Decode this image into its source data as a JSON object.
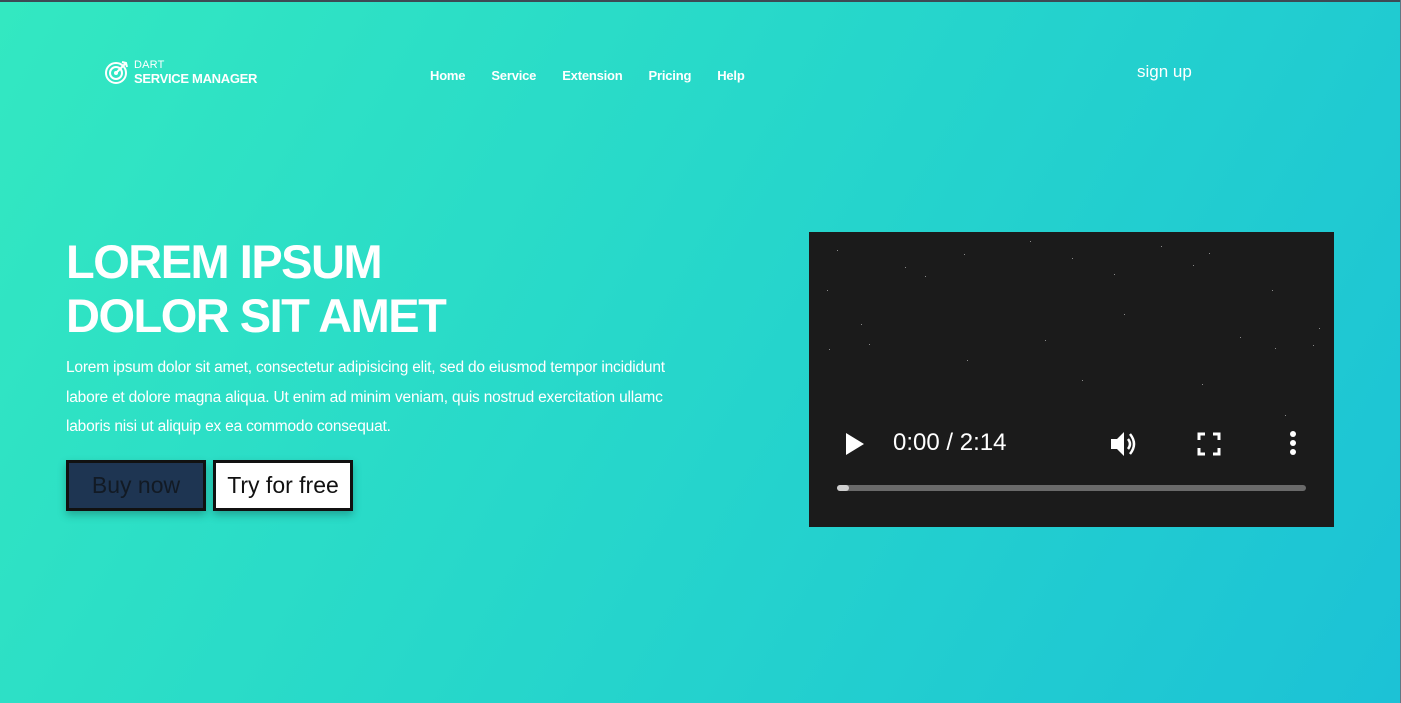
{
  "logo": {
    "top_text": "DART",
    "bottom_text": "SERVICE MANAGER",
    "icon": "target-icon"
  },
  "nav": {
    "items": [
      {
        "label": "Home"
      },
      {
        "label": "Service"
      },
      {
        "label": "Extension"
      },
      {
        "label": "Pricing"
      },
      {
        "label": "Help"
      }
    ],
    "signup_label": "sign up"
  },
  "hero": {
    "title_line1": "LOREM IPSUM",
    "title_line2": "DOLOR SIT AMET",
    "text": "Lorem ipsum dolor sit amet, consectetur adipisicing elit, sed do eiusmod tempor incididunt labore et dolore magna aliqua. Ut enim ad minim veniam, quis nostrud exercitation ullamc laboris nisi ut aliquip ex ea commodo consequat.",
    "buy_label": "Buy now",
    "try_label": "Try for free"
  },
  "video": {
    "time_display": "0:00 / 2:14",
    "current_time": "0:00",
    "duration": "2:14",
    "progress_fraction": 0.02,
    "icons": [
      "play-icon",
      "volume-icon",
      "fullscreen-icon",
      "more-vert-icon"
    ]
  },
  "colors": {
    "gradient_start": "#33e8c1",
    "gradient_end": "#1cc2d6",
    "buy_button_bg": "#1e3552",
    "video_bg": "#1b1b1b"
  }
}
